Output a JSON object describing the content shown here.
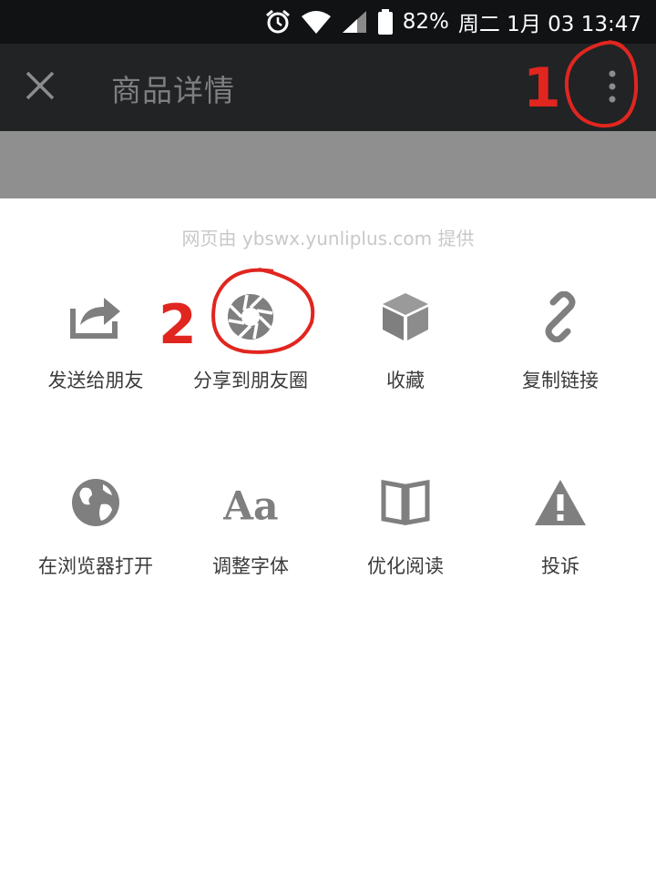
{
  "status_bar": {
    "battery_percent": "82%",
    "datetime": "周二 1月 03 13:47",
    "icons": [
      "alarm-icon",
      "wifi-icon",
      "signal-icon",
      "battery-icon"
    ]
  },
  "header": {
    "title": "商品详情",
    "close_icon": "close-icon",
    "more_icon": "more-vertical-icon"
  },
  "share_sheet": {
    "provider_text": "网页由 ybswx.yunliplus.com 提供",
    "items": [
      {
        "label": "发送给朋友",
        "icon": "share-forward-icon"
      },
      {
        "label": "分享到朋友圈",
        "icon": "moments-aperture-icon"
      },
      {
        "label": "收藏",
        "icon": "favorite-cube-icon"
      },
      {
        "label": "复制链接",
        "icon": "link-icon"
      },
      {
        "label": "在浏览器打开",
        "icon": "globe-icon"
      },
      {
        "label": "调整字体",
        "icon": "font-size-icon"
      },
      {
        "label": "优化阅读",
        "icon": "book-icon"
      },
      {
        "label": "投诉",
        "icon": "warning-icon"
      }
    ]
  },
  "annotations": {
    "step1": "1",
    "step2": "2",
    "color": "#e0261f"
  },
  "colors": {
    "status_bar_bg": "#101214",
    "header_bg": "#212325",
    "icon_gray": "#7f7f7f",
    "dim_band": "#8f8f8f"
  }
}
